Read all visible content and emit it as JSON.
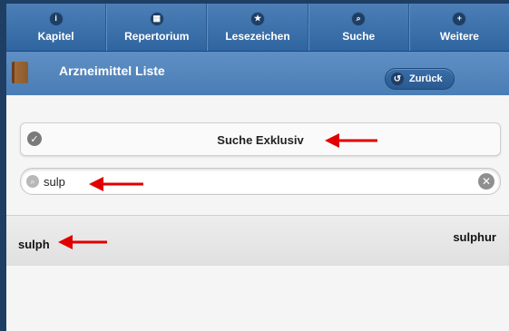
{
  "nav": {
    "items": [
      {
        "label": "Kapitel",
        "icon": "info-icon",
        "glyph": "i"
      },
      {
        "label": "Repertorium",
        "icon": "grid-icon",
        "glyph": "▦"
      },
      {
        "label": "Lesezeichen",
        "icon": "star-icon",
        "glyph": "★"
      },
      {
        "label": "Suche",
        "icon": "search-icon",
        "glyph": "⌕"
      },
      {
        "label": "Weitere",
        "icon": "plus-icon",
        "glyph": "+"
      }
    ]
  },
  "header": {
    "title": "Arzneimittel Liste",
    "back_label": "Zurück"
  },
  "filter": {
    "exklusiv_label": "Suche Exklusiv"
  },
  "search": {
    "value": "sulp"
  },
  "results": [
    {
      "left": "sulph",
      "right": "sulphur"
    }
  ],
  "colors": {
    "nav_bg": "#3b6ea6",
    "header_bg": "#5486bd",
    "annotation_arrow": "#e00000"
  }
}
